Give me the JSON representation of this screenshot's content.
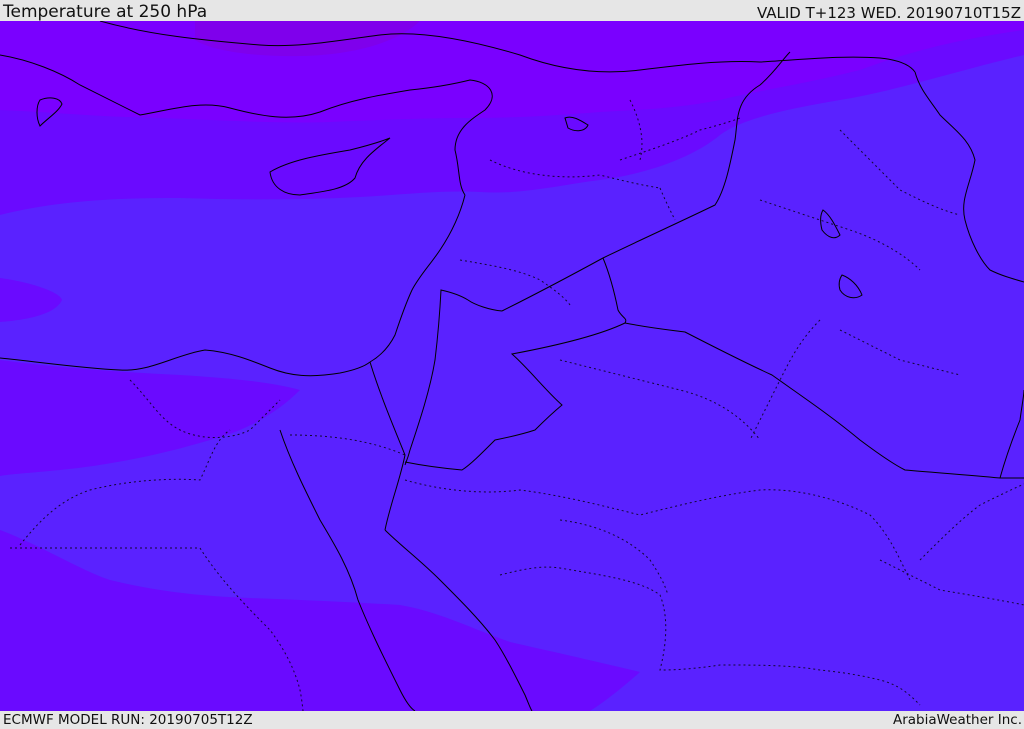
{
  "header": {
    "title": "Temperature at 250 hPa",
    "valid": "VALID T+123 WED. 20190710T15Z"
  },
  "footer": {
    "model_run": "ECMWF MODEL RUN: 20190705T12Z",
    "credit": "ArabiaWeather Inc."
  },
  "map": {
    "variable": "temperature",
    "level": "250 hPa",
    "colors": {
      "coldest": "#7a0cff",
      "cold": "#6a0aff",
      "mid": "#5a22ff",
      "deep": "#8200e0",
      "border": "#000000"
    }
  }
}
